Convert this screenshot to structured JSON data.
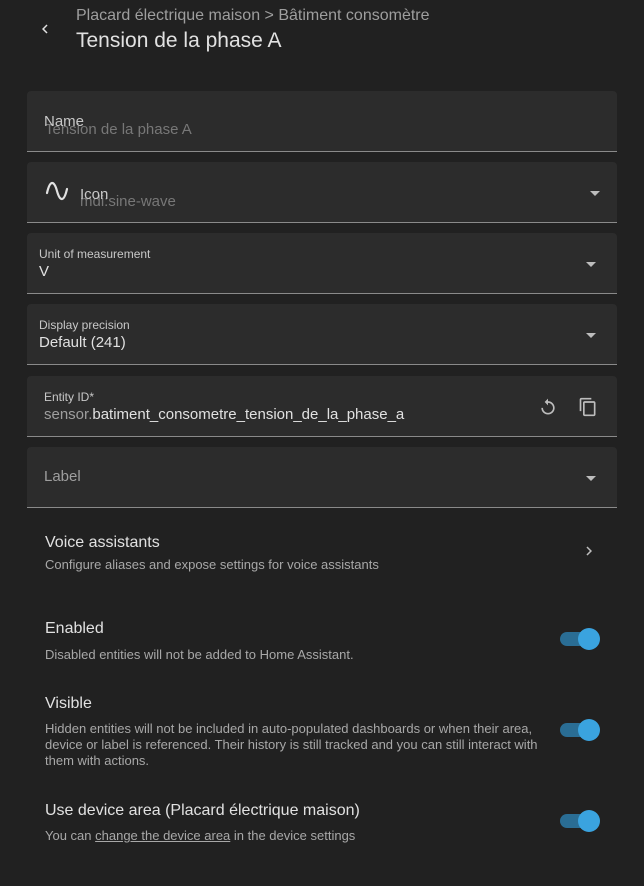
{
  "header": {
    "breadcrumb": "Placard électrique maison > Bâtiment consomètre",
    "title": "Tension de la phase A"
  },
  "fields": {
    "name": {
      "label": "Name",
      "placeholder": "Tension de la phase A"
    },
    "icon": {
      "label": "Icon",
      "placeholder": "mdi:sine-wave",
      "icon_name": "sine-wave-icon"
    },
    "unit": {
      "label": "Unit of measurement",
      "value": "V"
    },
    "precision": {
      "label": "Display precision",
      "value": "Default (241)"
    },
    "entity_id": {
      "label": "Entity ID*",
      "prefix": "sensor.",
      "value": "batiment_consometre_tension_de_la_phase_a"
    },
    "label": {
      "label": "Label"
    }
  },
  "voice": {
    "title": "Voice assistants",
    "description": "Configure aliases and expose settings for voice assistants"
  },
  "enabled": {
    "title": "Enabled",
    "description": "Disabled entities will not be added to Home Assistant.",
    "on": true
  },
  "visible": {
    "title": "Visible",
    "description": "Hidden entities will not be included in auto-populated dashboards or when their area, device or label is referenced. Their history is still tracked and you can still interact with them with actions.",
    "on": true
  },
  "device_area": {
    "title": "Use device area (Placard électrique maison)",
    "desc_before": "You can ",
    "desc_link": "change the device area",
    "desc_after": " in the device settings",
    "on": true
  },
  "colors": {
    "background": "#212121",
    "field_bg": "#2c2c2c",
    "accent": "#3aa3df",
    "track": "#2a6d94"
  }
}
